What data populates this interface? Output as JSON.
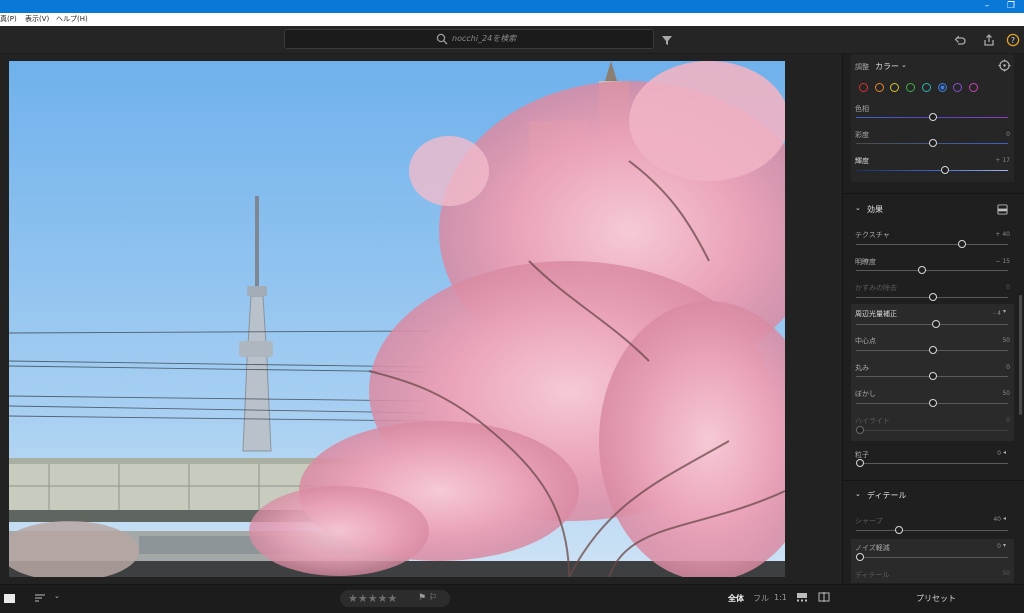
{
  "titlebar": {
    "restore_icon": "restore-window-icon",
    "minimize_icon": "minimize-icon"
  },
  "menu": {
    "items": [
      "真(P)",
      "表示(V)",
      "ヘルプ(H)"
    ]
  },
  "toolbar": {
    "search_placeholder": "nocchi_24を検索",
    "filter_icon": "filter-icon",
    "undo_icon": "undo-icon",
    "share_icon": "share-icon",
    "help_icon": "help-icon"
  },
  "panel": {
    "color": {
      "adjust_label": "調整",
      "mode": "カラー",
      "swatches": [
        "#d9312e",
        "#e8862a",
        "#d9c42a",
        "#3fae46",
        "#2fb3b0",
        "#3d7de0",
        "#8a4fd6",
        "#cf44b5"
      ],
      "selected_swatch": 5,
      "sliders": [
        {
          "label": "色相",
          "value": ""
        },
        {
          "label": "彩度",
          "value": "0"
        },
        {
          "label": "輝度",
          "value": "+ 17"
        }
      ]
    },
    "effects": {
      "title": "効果",
      "sliders": [
        {
          "label": "テクスチャ",
          "value": "+ 40"
        },
        {
          "label": "明瞭度",
          "value": "− 15"
        },
        {
          "label": "かすみの除去",
          "value": "0"
        }
      ],
      "vignette": {
        "label": "周辺光量補正",
        "value": "- 4",
        "sliders": [
          {
            "label": "中心点",
            "value": "50"
          },
          {
            "label": "丸み",
            "value": "0"
          },
          {
            "label": "ぼかし",
            "value": "50"
          },
          {
            "label": "ハイライト",
            "value": "0"
          }
        ]
      },
      "grain": {
        "label": "粒子",
        "value": "0"
      }
    },
    "detail": {
      "title": "ディテール",
      "sharpen": {
        "label": "シャープ",
        "value": "40"
      },
      "noise": {
        "label": "ノイズ軽減",
        "value": "0"
      },
      "detail_label": "ディテール",
      "detail_value": "50"
    }
  },
  "bottom": {
    "stars": "★★★★★",
    "flags": "⚑ ⚐",
    "view_all": "全体",
    "view_full": "フル",
    "view_ratio": "1:1",
    "presets": "プリセット"
  }
}
